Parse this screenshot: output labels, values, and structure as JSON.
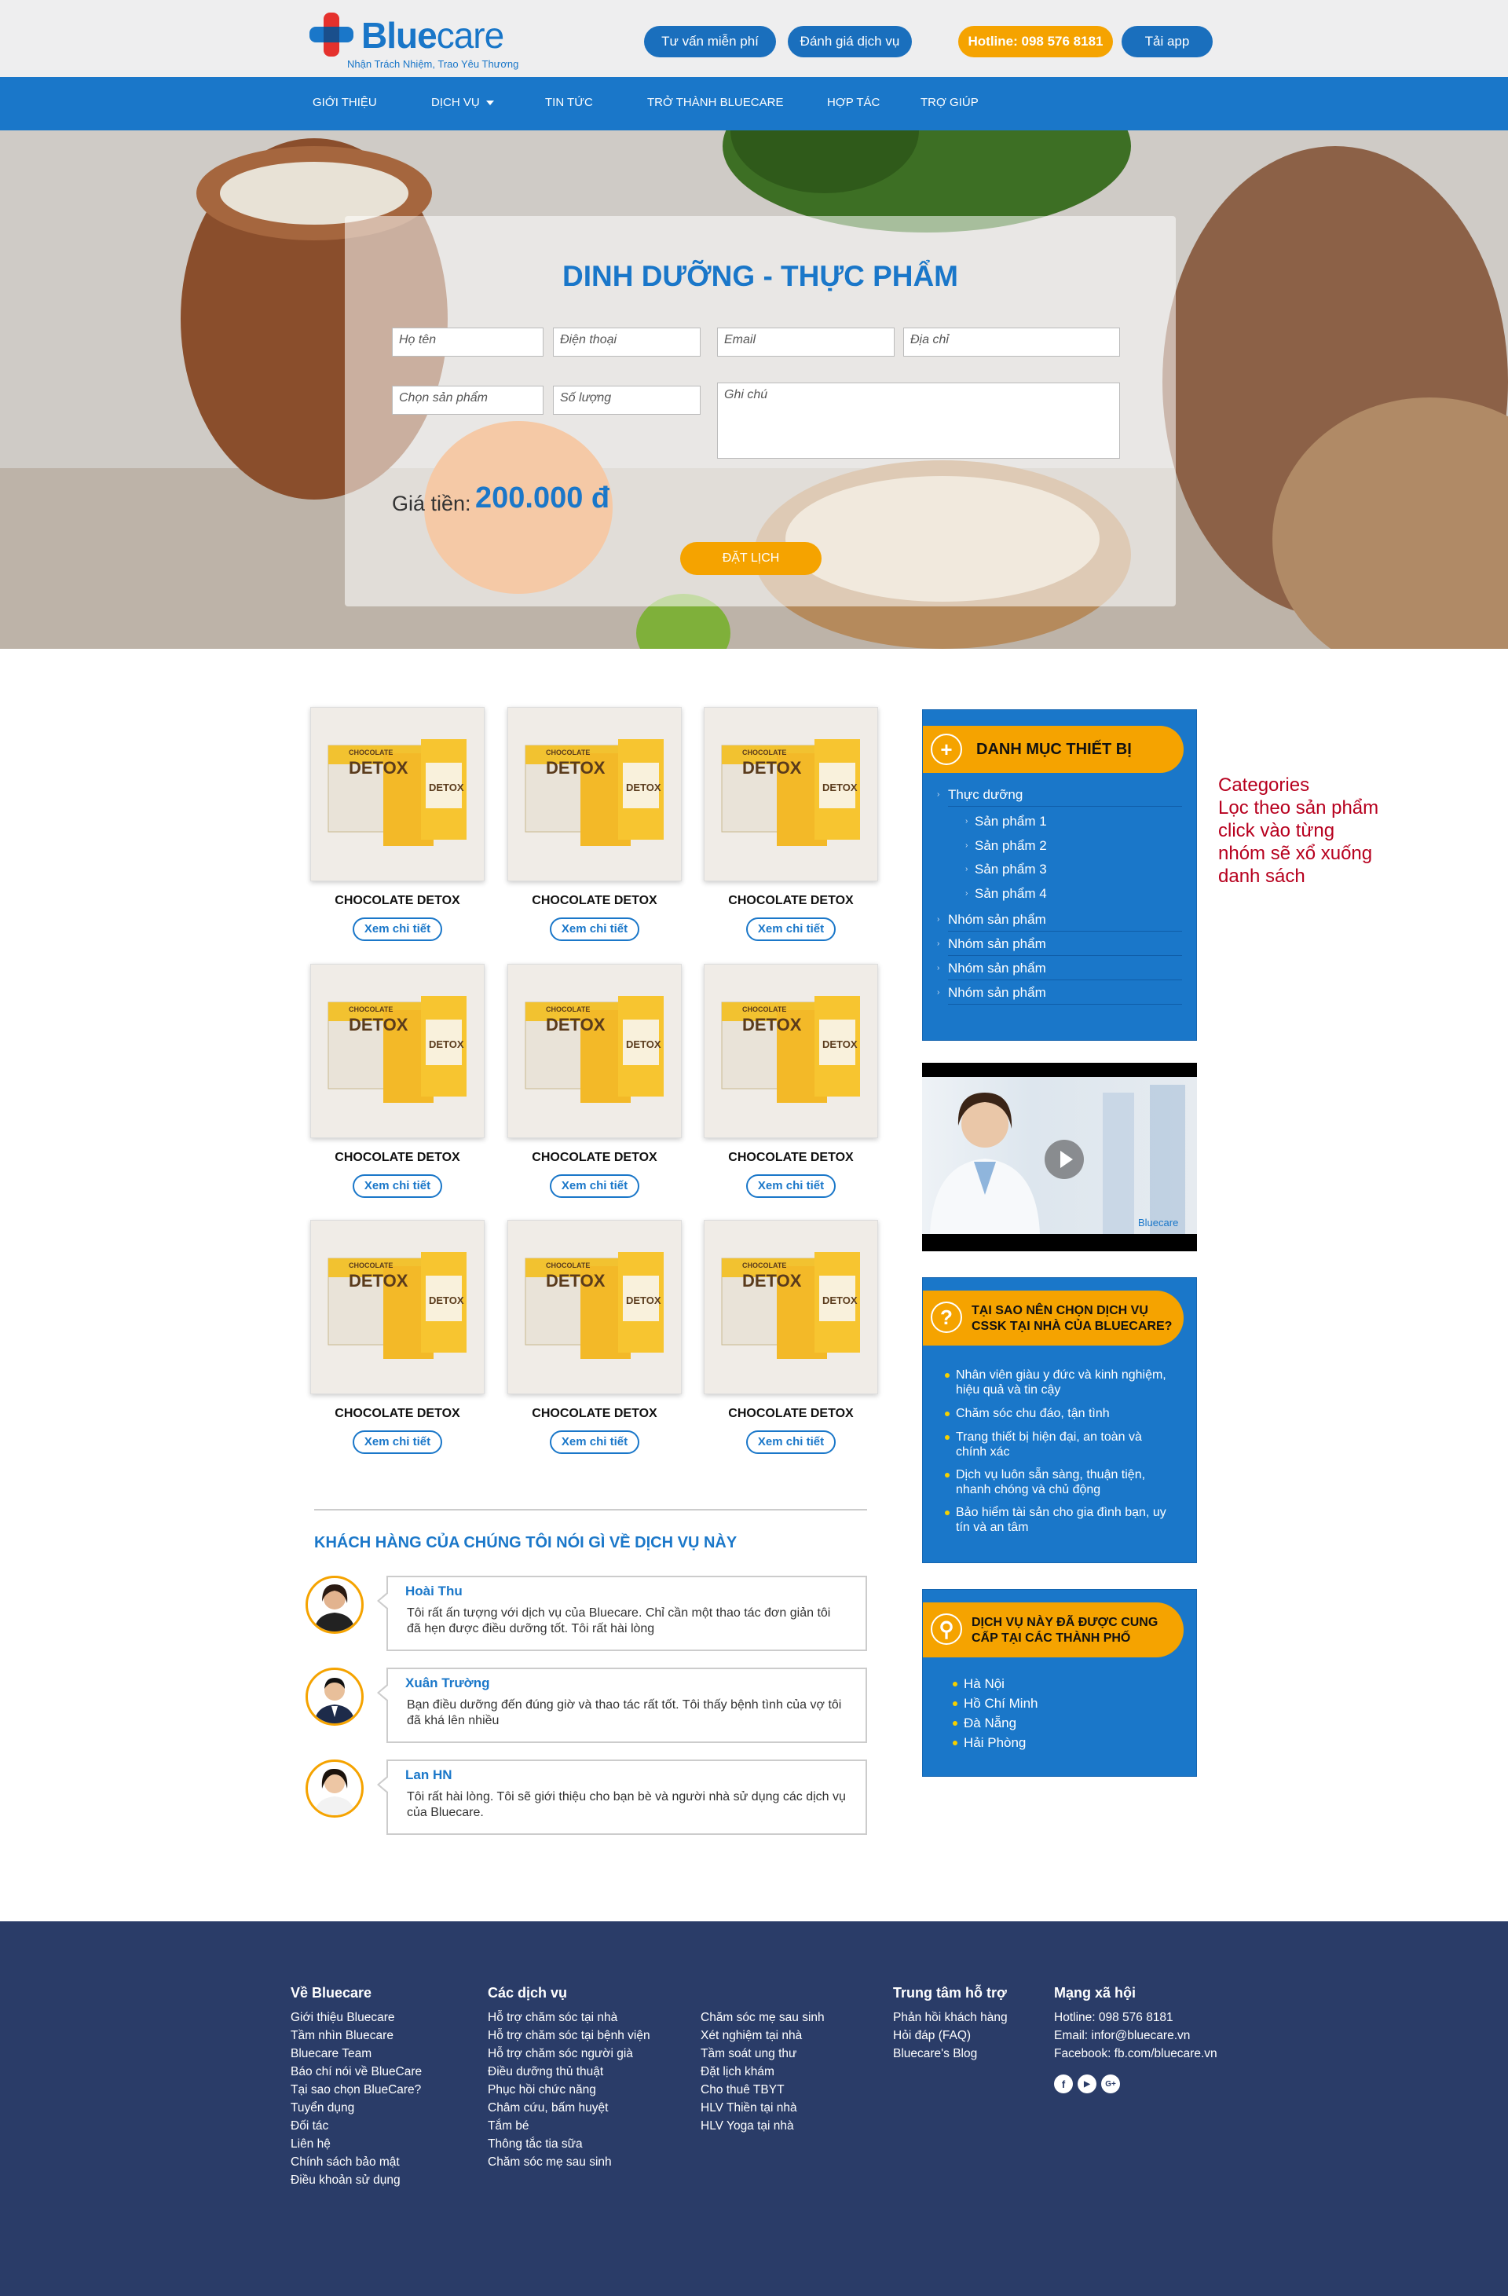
{
  "brand": {
    "name_a": "Blue",
    "name_b": "care",
    "slogan": "Nhận Trách Nhiệm, Trao Yêu Thương"
  },
  "header": {
    "btn_consult": "Tư vấn miễn phí",
    "btn_rate": "Đánh giá dịch vụ",
    "hotline": "Hotline: 098 576 8181",
    "download": "Tải app"
  },
  "nav": {
    "items": [
      "GIỚI THIỆU",
      "DỊCH VỤ",
      "TIN TỨC",
      "TRỞ THÀNH BLUECARE",
      "HỢP TÁC",
      "TRỢ GIÚP"
    ]
  },
  "hero": {
    "title": "DINH DƯỠNG - THỰC PHẨM",
    "placeholders": {
      "name": "Họ tên",
      "phone": "Điện thoại",
      "email": "Email",
      "address": "Địa chỉ",
      "product": "Chọn sản phẩm",
      "quantity": "Số lượng",
      "note": "Ghi chú"
    },
    "price_label": "Giá tiền:",
    "price": "200.000 đ",
    "book": "ĐẶT LỊCH"
  },
  "products": [
    {
      "name": "CHOCOLATE DETOX",
      "cta": "Xem chi tiết"
    },
    {
      "name": "CHOCOLATE DETOX",
      "cta": "Xem chi tiết"
    },
    {
      "name": "CHOCOLATE DETOX",
      "cta": "Xem chi tiết"
    },
    {
      "name": "CHOCOLATE DETOX",
      "cta": "Xem chi tiết"
    },
    {
      "name": "CHOCOLATE DETOX",
      "cta": "Xem chi tiết"
    },
    {
      "name": "CHOCOLATE DETOX",
      "cta": "Xem chi tiết"
    },
    {
      "name": "CHOCOLATE DETOX",
      "cta": "Xem chi tiết"
    },
    {
      "name": "CHOCOLATE DETOX",
      "cta": "Xem chi tiết"
    },
    {
      "name": "CHOCOLATE DETOX",
      "cta": "Xem chi tiết"
    }
  ],
  "product_box": {
    "brand_small": "CHOCOLATE",
    "brand_big": "DETOX"
  },
  "testimonials": {
    "title": "KHÁCH HÀNG CỦA CHÚNG TÔI NÓI GÌ VỀ DỊCH VỤ NÀY",
    "items": [
      {
        "name": "Hoài Thu",
        "text": "Tôi rất ấn tượng với dịch vụ của Bluecare. Chỉ cần một thao tác đơn giản tôi đã hẹn được điều dưỡng tốt. Tôi rất hài lòng"
      },
      {
        "name": "Xuân Trường",
        "text": "Bạn điều dưỡng đến đúng giờ và thao tác rất tốt. Tôi thấy bệnh tình của vợ tôi đã khá lên nhiều"
      },
      {
        "name": "Lan HN",
        "text": "Tôi rất hài lòng. Tôi sẽ giới thiệu cho bạn bè và người nhà sử dụng các dịch vụ của Bluecare."
      }
    ]
  },
  "categories": {
    "title": "DANH MỤC THIẾT BỊ",
    "group": "Thực dưỡng",
    "subs": [
      "Sản phẩm 1",
      "Sản phẩm 2",
      "Sản phẩm 3",
      "Sản phẩm 4"
    ],
    "groups": [
      "Nhóm sản phẩm",
      "Nhóm sản phẩm",
      "Nhóm sản phẩm",
      "Nhóm sản phẩm"
    ]
  },
  "video": {
    "watermark": "Bluecare"
  },
  "why": {
    "title_1": "TẠI SAO NÊN CHỌN DỊCH VỤ",
    "title_2": "CSSK TẠI NHÀ CỦA BLUECARE?",
    "items": [
      "Nhân viên giàu y đức và kinh nghiệm, hiệu quả và tin cậy",
      "Chăm sóc chu đáo, tận tình",
      "Trang thiết bị hiện đại, an toàn và chính xác",
      "Dịch vụ luôn sẵn sàng, thuận tiện, nhanh chóng và chủ động",
      "Bảo hiểm tài sản cho gia đình bạn, uy tín và an tâm"
    ]
  },
  "cities": {
    "title_1": "DỊCH VỤ NÀY ĐÃ ĐƯỢC CUNG",
    "title_2": "CẤP TẠI CÁC THÀNH PHỐ",
    "items": [
      "Hà Nội",
      "Hồ Chí Minh",
      "Đà Nẵng",
      "Hải Phòng"
    ]
  },
  "annotation": [
    "Categories",
    "Lọc theo sản phẩm",
    "click vào từng",
    "nhóm sẽ xổ xuống",
    "danh sách"
  ],
  "footer": {
    "about": {
      "title": "Về Bluecare",
      "links": [
        "Giới thiệu Bluecare",
        "Tầm nhìn Bluecare",
        "Bluecare Team",
        "Báo chí nói về BlueCare",
        "Tại sao chọn BlueCare?",
        "Tuyển dụng",
        "Đối tác",
        "Liên hệ",
        "Chính sách bảo mật",
        "Điều khoản sử dụng"
      ]
    },
    "services": {
      "title": "Các dịch vụ",
      "links": [
        "Hỗ trợ chăm sóc tại nhà",
        "Hỗ trợ chăm sóc tại bệnh viện",
        "Hỗ trợ chăm sóc người già",
        "Điều dưỡng thủ thuật",
        "Phục hồi chức năng",
        "Châm cứu, bấm huyệt",
        "Tắm bé",
        "Thông tắc tia sữa",
        "Chăm sóc mẹ sau sinh"
      ]
    },
    "services2": {
      "links": [
        "Chăm sóc mẹ sau sinh",
        "Xét nghiệm tại nhà",
        "Tầm soát ung thư",
        "Đặt lịch khám",
        "Cho thuê TBYT",
        "HLV Thiền tại nhà",
        "HLV Yoga tại nhà"
      ]
    },
    "support": {
      "title": "Trung tâm hỗ trợ",
      "links": [
        "Phản hồi khách hàng",
        "Hỏi đáp (FAQ)",
        "Bluecare's Blog"
      ]
    },
    "social": {
      "title": "Mạng xã hội",
      "links": [
        "Hotline: 098 576 8181",
        "Email: infor@bluecare.vn",
        "Facebook: fb.com/bluecare.vn"
      ],
      "icons": [
        "f",
        "▶",
        "G+"
      ]
    }
  }
}
